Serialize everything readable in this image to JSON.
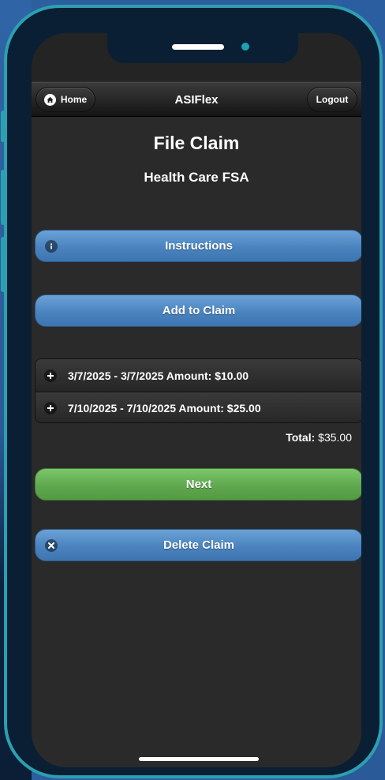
{
  "header": {
    "home_label": "Home",
    "title": "ASIFlex",
    "logout_label": "Logout"
  },
  "page": {
    "title": "File Claim",
    "subtitle": "Health Care FSA"
  },
  "buttons": {
    "instructions": "Instructions",
    "add_to_claim": "Add to Claim",
    "next": "Next",
    "delete_claim": "Delete Claim"
  },
  "claims": [
    {
      "label": "3/7/2025 - 3/7/2025 Amount: $10.00"
    },
    {
      "label": "7/10/2025 - 7/10/2025 Amount: $25.00"
    }
  ],
  "total": {
    "label": "Total:",
    "value": "$35.00"
  },
  "icons": {
    "home": "home-icon",
    "info": "info-icon",
    "plus": "plus-icon",
    "delete": "close-icon"
  },
  "colors": {
    "primary_button": "#4a83bf",
    "next_button": "#5fa84e",
    "screen_background": "#2a2a2a",
    "phone_frame": "#2d9fb1"
  }
}
